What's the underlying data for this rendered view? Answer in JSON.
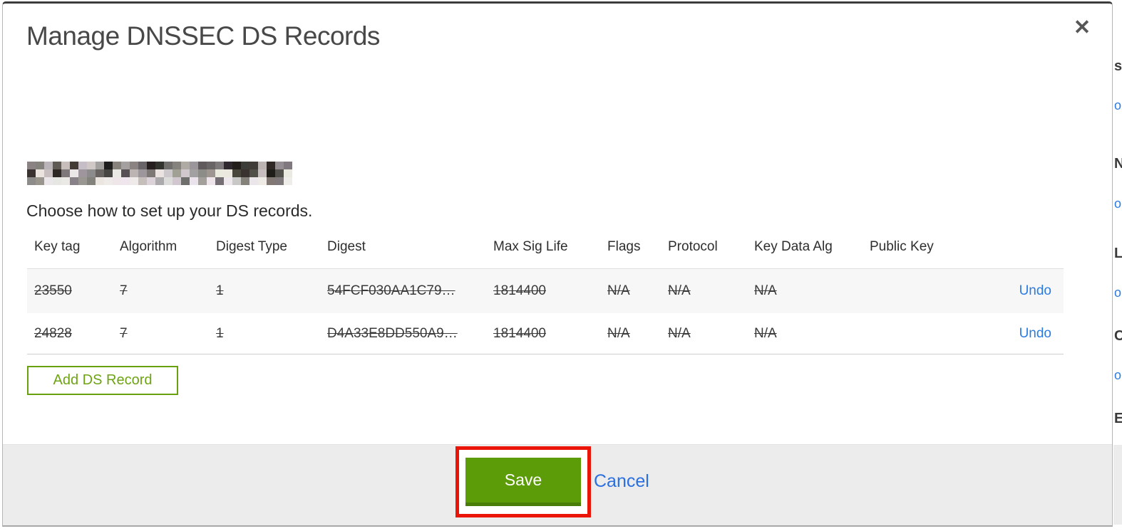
{
  "modal": {
    "title": "Manage DNSSEC DS Records",
    "close_icon": "✕",
    "instruction": "Choose how to set up your DS records.",
    "table": {
      "columns": [
        "Key tag",
        "Algorithm",
        "Digest Type",
        "Digest",
        "Max Sig Life",
        "Flags",
        "Protocol",
        "Key Data Alg",
        "Public Key"
      ],
      "rows": [
        {
          "key_tag": "23550",
          "algorithm": "7",
          "digest_type": "1",
          "digest": "54FCF030AA1C79…",
          "max_sig_life": "1814400",
          "flags": "N/A",
          "protocol": "N/A",
          "key_data_alg": "N/A",
          "public_key": "",
          "action": "Undo",
          "struck": true
        },
        {
          "key_tag": "24828",
          "algorithm": "7",
          "digest_type": "1",
          "digest": "D4A33E8DD550A9…",
          "max_sig_life": "1814400",
          "flags": "N/A",
          "protocol": "N/A",
          "key_data_alg": "N/A",
          "public_key": "",
          "action": "Undo",
          "struck": true
        }
      ]
    },
    "add_button_label": "Add DS Record",
    "footer": {
      "save_label": "Save",
      "cancel_label": "Cancel"
    }
  },
  "redaction": {
    "cols": 31,
    "rows": 3
  },
  "backdrop": {
    "fragments": [
      "s",
      "o",
      "N",
      "o",
      "L",
      "o",
      "C",
      "o",
      "E"
    ]
  },
  "colors": {
    "save_green": "#5c9c08",
    "save_green_dark": "#497c09",
    "add_button_green": "#69a00d",
    "link_blue": "#2b7be0",
    "annotation_red": "#ea1508",
    "footer_gray": "#ececec",
    "row_stripe": "#f7f7f7"
  }
}
